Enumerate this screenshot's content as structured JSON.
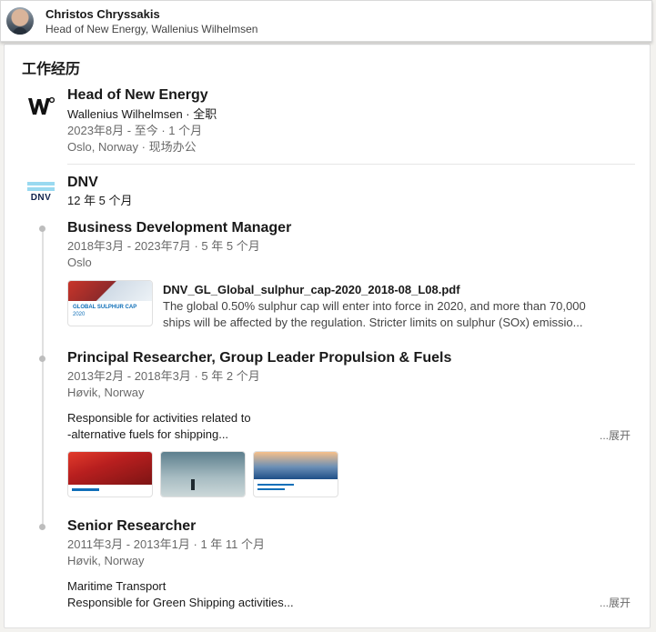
{
  "header": {
    "name": "Christos Chryssakis",
    "headline": "Head of New Energy, Wallenius Wilhelmsen"
  },
  "section": {
    "title": "工作经历"
  },
  "experience1": {
    "title": "Head of New Energy",
    "company": "Wallenius Wilhelmsen · 全职",
    "dates": "2023年8月 - 至今 · 1 个月",
    "location": "Oslo, Norway · 现场办公",
    "logo_text": "W°"
  },
  "experience2": {
    "company": "DNV",
    "duration": "12 年 5 个月",
    "logo_text": "DNV",
    "roles": [
      {
        "title": "Business Development Manager",
        "dates": "2018年3月 - 2023年7月 · 5 年 5 个月",
        "location": "Oslo",
        "media": {
          "title": "DNV_GL_Global_sulphur_cap-2020_2018-08_L08.pdf",
          "desc_line1": "The global 0.50% sulphur cap will enter into force in 2020, and more than 70,000",
          "desc_line2": "ships will be affected by the regulation. Stricter limits on sulphur (SOx) emissio...",
          "thumb_text1": "GLOBAL SULPHUR CAP",
          "thumb_text2": "2020"
        }
      },
      {
        "title": "Principal Researcher, Group Leader Propulsion & Fuels",
        "dates": "2013年2月 - 2018年3月 · 5 年 2 个月",
        "location": "Høvik, Norway",
        "desc_line1": "Responsible for activities related to",
        "desc_line2": "-alternative fuels for shipping...",
        "more": "...展开"
      },
      {
        "title": "Senior Researcher",
        "dates": "2011年3月 - 2013年1月 · 1 年 11 个月",
        "location": "Høvik, Norway",
        "desc_line1": "Maritime Transport",
        "desc_line2": "Responsible for Green Shipping activities...",
        "more": "...展开"
      }
    ]
  },
  "colors": {
    "dnv_blue": "#0f204b",
    "dnv_cyan": "#99d9f0",
    "thumb_red": "#c8352a",
    "link_blue": "#0a66c2"
  }
}
